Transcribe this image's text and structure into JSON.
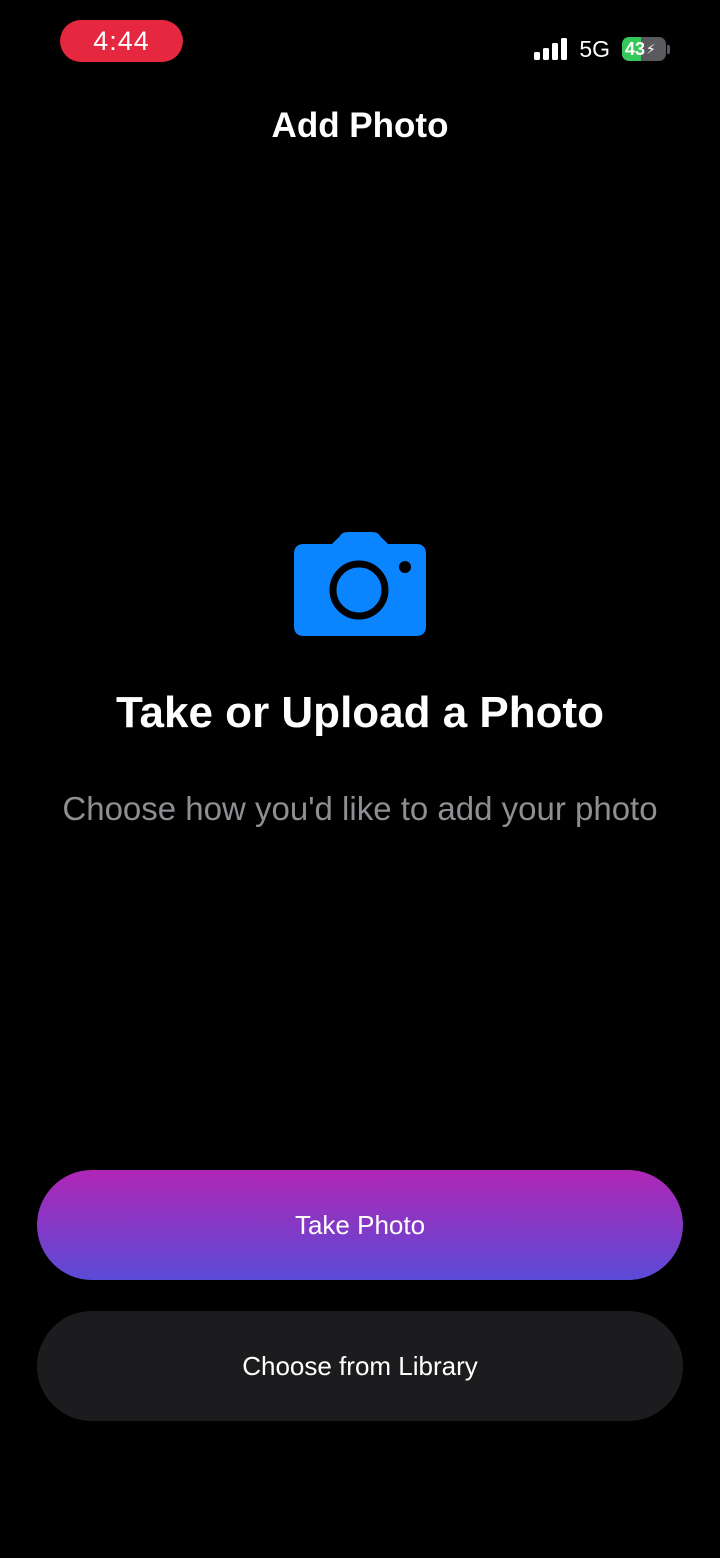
{
  "status_bar": {
    "time": "4:44",
    "network": "5G",
    "battery_level": "43",
    "battery_percent": 43,
    "time_pill_color": "#e5273f",
    "battery_fill_color": "#34c759"
  },
  "header": {
    "title": "Add Photo"
  },
  "main": {
    "icon": "camera-icon",
    "icon_color": "#0a84ff",
    "headline": "Take or Upload a Photo",
    "subtitle": "Choose how you'd like to add your photo"
  },
  "actions": {
    "take_photo_label": "Take Photo",
    "choose_library_label": "Choose from Library",
    "primary_gradient": [
      "#b026b5",
      "#5a4bd6"
    ]
  }
}
